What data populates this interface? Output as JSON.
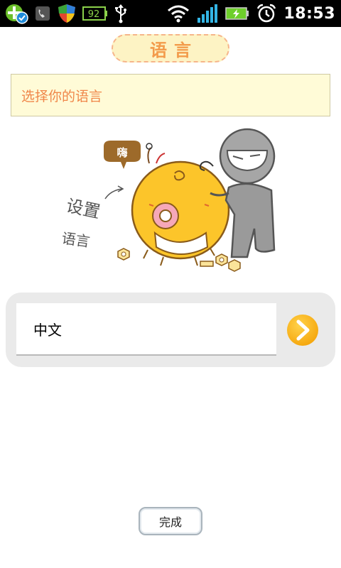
{
  "status_bar": {
    "battery_level": "92",
    "time": "18:53",
    "icons": [
      "app-plus-check-icon",
      "phone-icon",
      "shield-icon",
      "battery-indicator-icon",
      "usb-icon",
      "wifi-icon",
      "signal-icon",
      "battery-charging-icon",
      "alarm-icon"
    ]
  },
  "header": {
    "title": "语言"
  },
  "hint": {
    "text": "选择你的语言"
  },
  "illustration": {
    "caption_line1": "设置",
    "caption_line2": "语言",
    "speech_bubble": "嗨",
    "colors": {
      "ball": "#fcc52a",
      "robot": "#9a9a9a"
    }
  },
  "language_selector": {
    "selected_value": "中文",
    "next_icon": "chevron-right-icon",
    "accent_color": "#fbb415"
  },
  "footer": {
    "done_label": "完成"
  }
}
